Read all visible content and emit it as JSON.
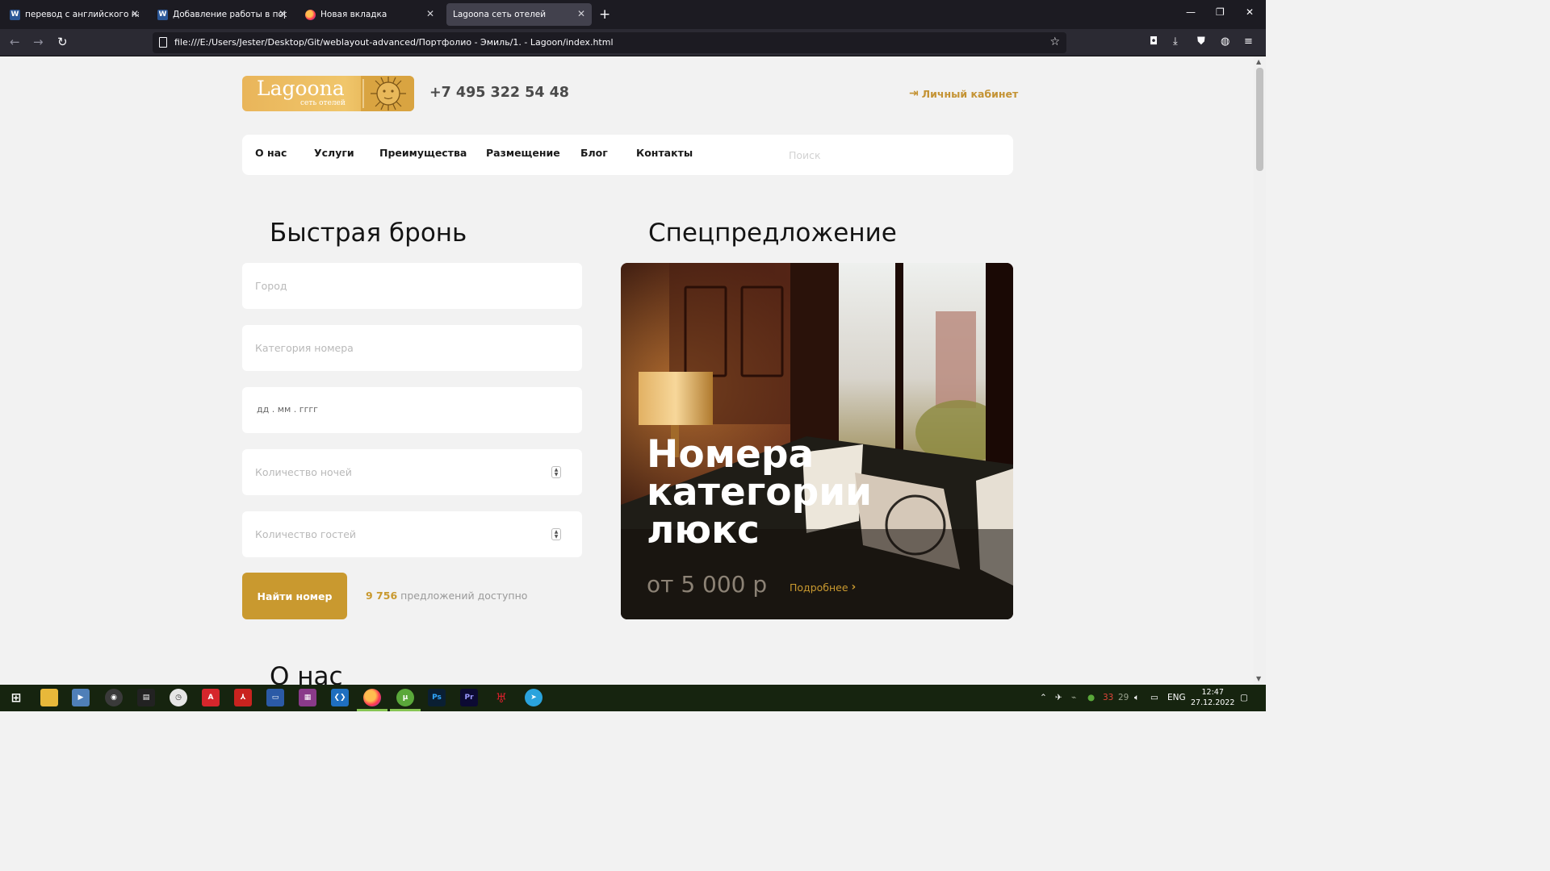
{
  "browser": {
    "tabs": [
      {
        "title": "перевод с английского на русс",
        "icon": "word-icon"
      },
      {
        "title": "Добавление работы в портфол",
        "icon": "word-icon"
      },
      {
        "title": "Новая вкладка",
        "icon": "firefox-icon"
      },
      {
        "title": "Lagoona сеть отелей",
        "icon": "",
        "active": true
      }
    ],
    "url": "file:///E:/Users/Jester/Desktop/Git/weblayout-advanced/Портфолио - Эмиль/1. - Lagoon/index.html"
  },
  "header": {
    "logo_name": "Lagoona",
    "logo_sub": "сеть отелей",
    "phone": "+7 495 322 54 48",
    "cabinet": "Личный кабинет"
  },
  "nav": {
    "items": [
      "О нас",
      "Услуги",
      "Преимущества",
      "Размещение",
      "Блог",
      "Контакты"
    ],
    "search_placeholder": "Поиск"
  },
  "booking": {
    "title": "Быстрая бронь",
    "city_placeholder": "Город",
    "category_placeholder": "Категория номера",
    "date_placeholder": "дд . мм . гггг",
    "nights_placeholder": "Количество ночей",
    "guests_placeholder": "Количество гостей",
    "find_button": "Найти номер",
    "offers_count": "9 756",
    "offers_text": "предложений доступно"
  },
  "special": {
    "title": "Спецпредложение",
    "card_title": "Номера категории люкс",
    "price": "от 5 000 р",
    "more": "Подробнее"
  },
  "about": {
    "title": "О нас"
  },
  "taskbar": {
    "lang": "ENG",
    "time": "12:47",
    "date": "27.12.2022",
    "tray_num_1": "33",
    "tray_num_2": "29"
  },
  "colors": {
    "accent_gold": "#c9992f",
    "page_bg": "#f2f2f2",
    "browser_dark": "#1c1b22"
  }
}
